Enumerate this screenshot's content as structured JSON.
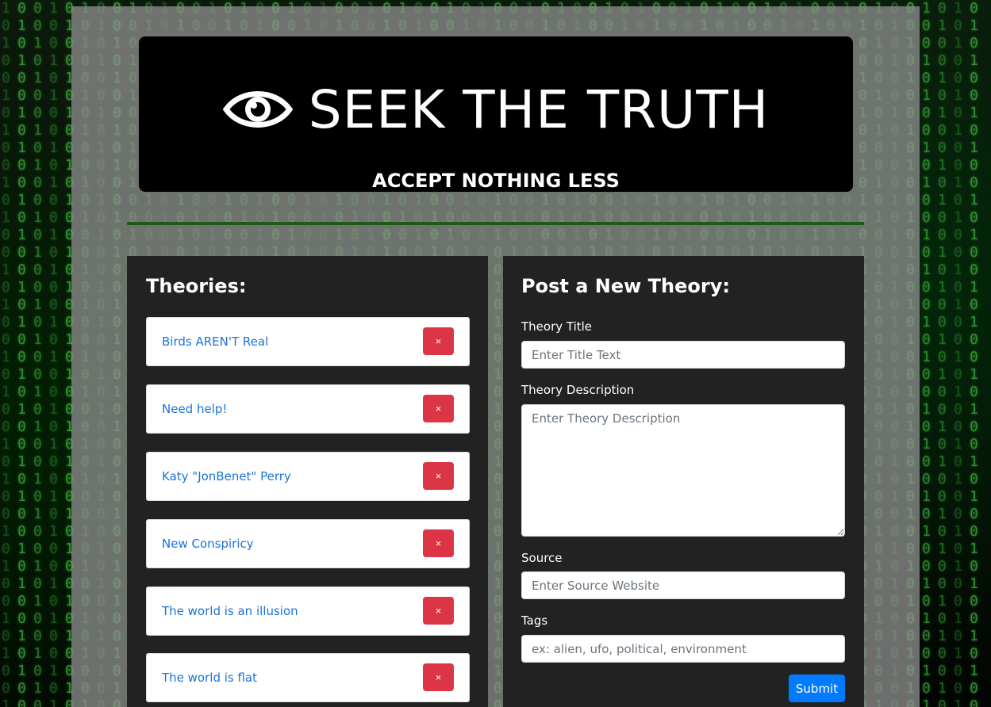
{
  "hero": {
    "title": "SEEK THE TRUTH",
    "subtitle": "ACCEPT NOTHING LESS",
    "icon": "eye-icon"
  },
  "theories": {
    "heading": "Theories:",
    "items": [
      {
        "title": "Birds AREN'T Real",
        "delete": "×"
      },
      {
        "title": "Need help!",
        "delete": "×"
      },
      {
        "title": "Katy \"JonBenet\" Perry",
        "delete": "×"
      },
      {
        "title": "New Conspiricy",
        "delete": "×"
      },
      {
        "title": "The world is an illusion",
        "delete": "×"
      },
      {
        "title": "The world is flat",
        "delete": "×"
      }
    ]
  },
  "form": {
    "heading": "Post a New Theory:",
    "title_label": "Theory Title",
    "title_placeholder": "Enter Title Text",
    "description_label": "Theory Description",
    "description_placeholder": "Enter Theory Description",
    "source_label": "Source",
    "source_placeholder": "Enter Source Website",
    "tags_label": "Tags",
    "tags_placeholder": "ex: alien, ufo, political, environment",
    "submit_label": "Submit"
  },
  "colors": {
    "accent": "#007bff",
    "danger": "#dc3545",
    "link": "#1a73d6",
    "divider": "#1f5a1a",
    "card": "#222222"
  }
}
